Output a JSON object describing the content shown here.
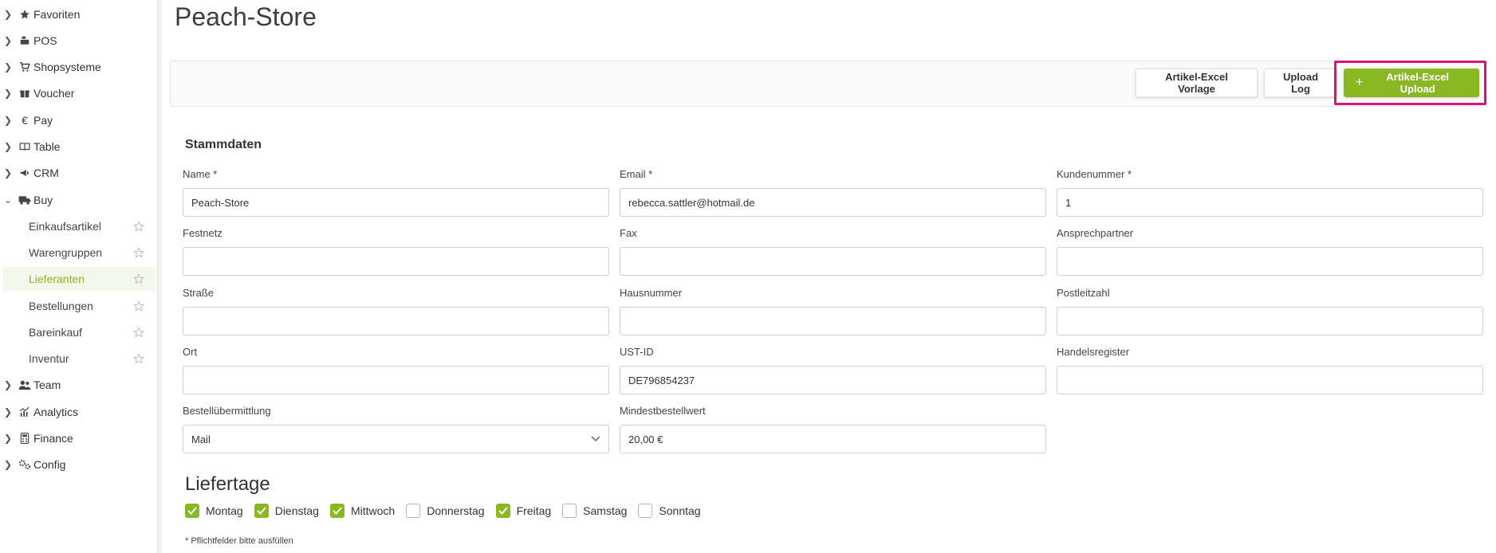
{
  "page": {
    "title": "Peach-Store"
  },
  "sidebar": {
    "items": [
      {
        "label": "Favoriten",
        "icon": "star-icon",
        "expanded": false
      },
      {
        "label": "POS",
        "icon": "cash-register-icon",
        "expanded": false
      },
      {
        "label": "Shopsysteme",
        "icon": "cart-icon",
        "expanded": false
      },
      {
        "label": "Voucher",
        "icon": "gift-icon",
        "expanded": false
      },
      {
        "label": "Pay",
        "icon": "euro-icon",
        "expanded": false
      },
      {
        "label": "Table",
        "icon": "book-icon",
        "expanded": false
      },
      {
        "label": "CRM",
        "icon": "megaphone-icon",
        "expanded": false
      },
      {
        "label": "Buy",
        "icon": "truck-icon",
        "expanded": true
      },
      {
        "label": "Team",
        "icon": "users-icon",
        "expanded": false
      },
      {
        "label": "Analytics",
        "icon": "chart-icon",
        "expanded": false
      },
      {
        "label": "Finance",
        "icon": "calculator-icon",
        "expanded": false
      },
      {
        "label": "Config",
        "icon": "gears-icon",
        "expanded": false
      }
    ],
    "buy_subitems": [
      {
        "label": "Einkaufsartikel",
        "active": false
      },
      {
        "label": "Warengruppen",
        "active": false
      },
      {
        "label": "Lieferanten",
        "active": true
      },
      {
        "label": "Bestellungen",
        "active": false
      },
      {
        "label": "Bareinkauf",
        "active": false
      },
      {
        "label": "Inventur",
        "active": false
      }
    ]
  },
  "toolbar": {
    "excel_template_label": "Artikel-Excel Vorlage",
    "upload_log_label": "Upload Log",
    "excel_upload_label": "Artikel-Excel Upload"
  },
  "stammdaten": {
    "title": "Stammdaten",
    "name": {
      "label": "Name *",
      "value": "Peach-Store"
    },
    "email": {
      "label": "Email *",
      "value": "rebecca.sattler@hotmail.de"
    },
    "kundennummer": {
      "label": "Kundenummer *",
      "value": "1"
    },
    "festnetz": {
      "label": "Festnetz",
      "value": ""
    },
    "fax": {
      "label": "Fax",
      "value": ""
    },
    "ansprechpartner": {
      "label": "Ansprechpartner",
      "value": ""
    },
    "strasse": {
      "label": "Straße",
      "value": ""
    },
    "hausnummer": {
      "label": "Hausnummer",
      "value": ""
    },
    "postleitzahl": {
      "label": "Postleitzahl",
      "value": ""
    },
    "ort": {
      "label": "Ort",
      "value": ""
    },
    "ustid": {
      "label": "UST-ID",
      "value": "DE796854237"
    },
    "handelsregister": {
      "label": "Handelsregister",
      "value": ""
    },
    "bestelluebermittlung": {
      "label": "Bestellübermittlung",
      "value": "Mail"
    },
    "mindestbestellwert": {
      "label": "Mindestbestellwert",
      "value": "20,00 €"
    }
  },
  "liefertage": {
    "title": "Liefertage",
    "days": [
      {
        "label": "Montag",
        "checked": true
      },
      {
        "label": "Dienstag",
        "checked": true
      },
      {
        "label": "Mittwoch",
        "checked": true
      },
      {
        "label": "Donnerstag",
        "checked": false
      },
      {
        "label": "Freitag",
        "checked": true
      },
      {
        "label": "Samstag",
        "checked": false
      },
      {
        "label": "Sonntag",
        "checked": false
      }
    ]
  },
  "footnote": "* Pflichtfelder bitte ausfüllen",
  "colors": {
    "accent": "#8ab822",
    "highlight": "#d4147a"
  }
}
